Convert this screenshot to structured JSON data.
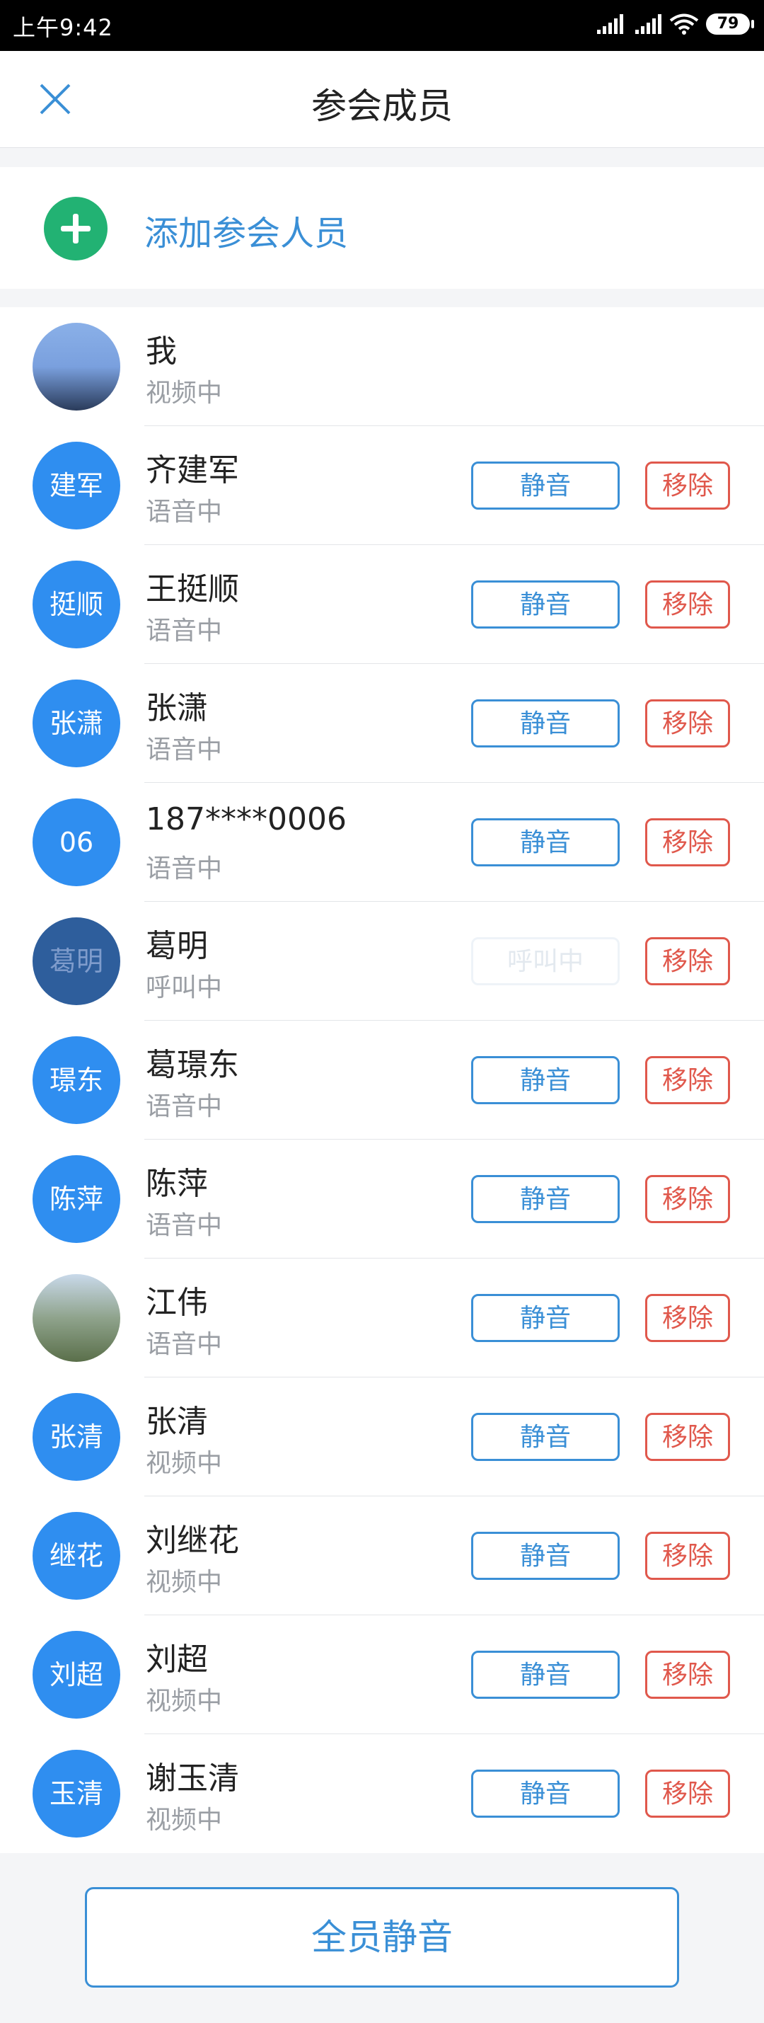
{
  "status_bar": {
    "time": "上午9:42",
    "battery": "79"
  },
  "header": {
    "title": "参会成员"
  },
  "add_row": {
    "label": "添加参会人员"
  },
  "members": [
    {
      "avatar_text": "",
      "avatar_kind": "photo-me",
      "name": "我",
      "status": "视频中",
      "mute_label": "",
      "remove_label": ""
    },
    {
      "avatar_text": "建军",
      "name": "齐建军",
      "status": "语音中",
      "mute_label": "静音",
      "remove_label": "移除"
    },
    {
      "avatar_text": "挺顺",
      "name": "王挺顺",
      "status": "语音中",
      "mute_label": "静音",
      "remove_label": "移除"
    },
    {
      "avatar_text": "张潇",
      "name": "张潇",
      "status": "语音中",
      "mute_label": "静音",
      "remove_label": "移除"
    },
    {
      "avatar_text": "06",
      "name": "187****0006",
      "status": "语音中",
      "mute_label": "静音",
      "remove_label": "移除"
    },
    {
      "avatar_text": "葛明",
      "avatar_kind": "calling",
      "name": "葛明",
      "status": "呼叫中",
      "mute_label": "呼叫中",
      "mute_disabled": true,
      "remove_label": "移除"
    },
    {
      "avatar_text": "璟东",
      "name": "葛璟东",
      "status": "语音中",
      "mute_label": "静音",
      "remove_label": "移除"
    },
    {
      "avatar_text": "陈萍",
      "name": "陈萍",
      "status": "语音中",
      "mute_label": "静音",
      "remove_label": "移除"
    },
    {
      "avatar_text": "",
      "avatar_kind": "photo-girl",
      "name": "江伟",
      "status": "语音中",
      "mute_label": "静音",
      "remove_label": "移除"
    },
    {
      "avatar_text": "张清",
      "name": "张清",
      "status": "视频中",
      "mute_label": "静音",
      "remove_label": "移除"
    },
    {
      "avatar_text": "继花",
      "name": "刘继花",
      "status": "视频中",
      "mute_label": "静音",
      "remove_label": "移除"
    },
    {
      "avatar_text": "刘超",
      "name": "刘超",
      "status": "视频中",
      "mute_label": "静音",
      "remove_label": "移除"
    },
    {
      "avatar_text": "玉清",
      "name": "谢玉清",
      "status": "视频中",
      "mute_label": "静音",
      "remove_label": "移除"
    }
  ],
  "footer": {
    "mute_all_label": "全员静音"
  },
  "colors": {
    "accent": "#3a8fd6",
    "danger": "#e0584c",
    "add_green": "#22b273",
    "avatar_blue": "#2f8ef0"
  }
}
